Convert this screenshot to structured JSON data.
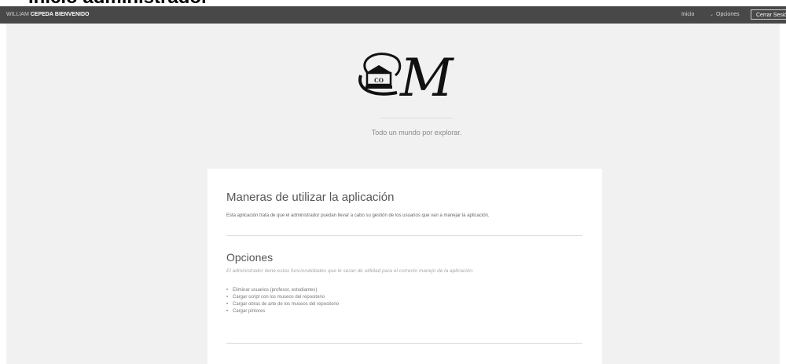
{
  "page_heading": "Inicio administrador",
  "navbar": {
    "user_first": "WILLIAM",
    "user_last": "CEPEDA",
    "welcome": "BIENVENIDO",
    "inicio": "Inicio",
    "opciones": "Opciones",
    "logout": "Cerrar Sesión"
  },
  "logo": {
    "monogram": "M",
    "building_text": "CO"
  },
  "tagline": "Todo un mundo por explorar.",
  "section1": {
    "title": "Maneras de utilizar la aplicación",
    "text": "Esta aplicación trata de que el administrador puedan llevar a cabo su gestión de los usuarios que van a manejar la aplicación."
  },
  "section2": {
    "title": "Opciones",
    "subtitle": "El administrador tiene estas funcionalidades que le seran de utilidad para el correcto manejo de la aplicación:",
    "items": [
      "Eliminar usuarios (profesor, estudiantes)",
      "Cargar script con los museos del repositorio",
      "Cargar obras de arte de los museos del repositorio",
      "Cargar pintores"
    ]
  }
}
